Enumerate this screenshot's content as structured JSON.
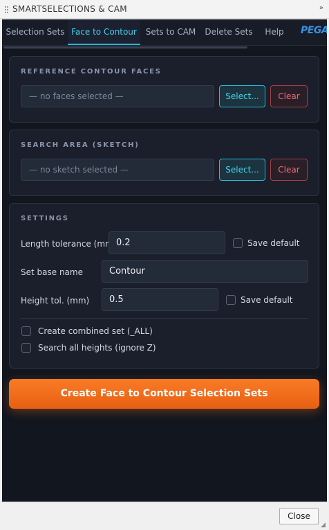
{
  "window": {
    "title": "SMARTSELECTIONS & CAM",
    "expand_glyph": "»"
  },
  "tabs": [
    {
      "label": "Selection Sets",
      "active": false
    },
    {
      "label": "Face to Contour",
      "active": true
    },
    {
      "label": "Sets to CAM",
      "active": false
    },
    {
      "label": "Delete Sets",
      "active": false
    },
    {
      "label": "Help",
      "active": false
    }
  ],
  "logo_text": "PEGAS",
  "reference": {
    "title": "REFERENCE CONTOUR FACES",
    "placeholder": "— no faces selected —",
    "select_label": "Select...",
    "clear_label": "Clear"
  },
  "search_area": {
    "title": "SEARCH AREA (SKETCH)",
    "placeholder": "— no sketch selected —",
    "select_label": "Select...",
    "clear_label": "Clear"
  },
  "settings": {
    "title": "SETTINGS",
    "length_tolerance": {
      "label": "Length tolerance (mm)",
      "value": "0.2",
      "save_default_label": "Save default",
      "save_default_checked": false
    },
    "base_name": {
      "label": "Set base name",
      "value": "Contour"
    },
    "height_tolerance": {
      "label": "Height tol. (mm)",
      "value": "0.5",
      "save_default_label": "Save default",
      "save_default_checked": false
    },
    "combined_set": {
      "label": "Create combined set (_ALL)",
      "checked": false
    },
    "all_heights": {
      "label": "Search all heights (ignore Z)",
      "checked": false
    }
  },
  "create_button_label": "Create Face to Contour Selection Sets",
  "close_label": "Close",
  "colors": {
    "panel_bg": "#12161f",
    "card_bg": "#1a1f2b",
    "accent_cyan": "#27bcd8",
    "danger_red": "#ef6b76",
    "cta_orange": "#f97316"
  }
}
